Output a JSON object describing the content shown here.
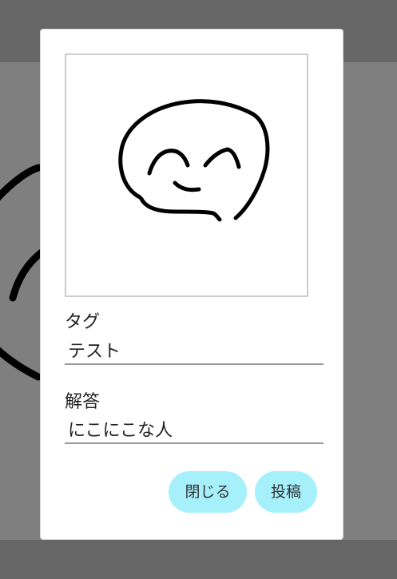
{
  "dialog": {
    "tag_label": "タグ",
    "tag_value": "テスト",
    "answer_label": "解答",
    "answer_value": "にこにこな人",
    "close_label": "閉じる",
    "post_label": "投稿"
  },
  "colors": {
    "button_bg": "#a6f0fc",
    "overlay": "#666666",
    "stroke": "#000000"
  }
}
